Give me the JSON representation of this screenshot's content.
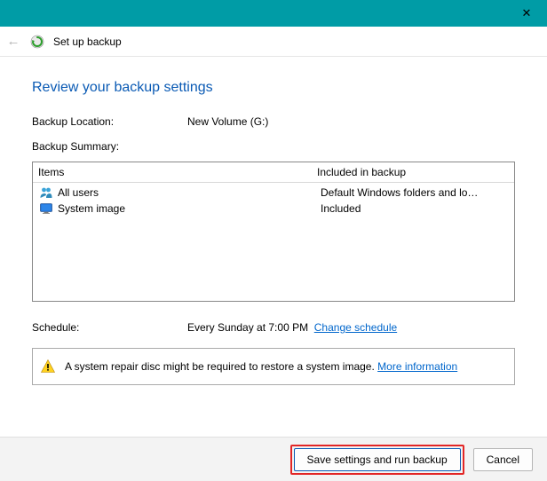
{
  "titlebar": {
    "close_glyph": "✕"
  },
  "crumb": {
    "title": "Set up backup"
  },
  "page": {
    "title": "Review your backup settings",
    "location_label": "Backup Location:",
    "location_value": "New Volume (G:)",
    "summary_label": "Backup Summary:",
    "col_items": "Items",
    "col_included": "Included in backup",
    "rows": [
      {
        "name": "All users",
        "included": "Default Windows folders and lo…"
      },
      {
        "name": "System image",
        "included": "Included"
      }
    ],
    "schedule_label": "Schedule:",
    "schedule_value": "Every Sunday at 7:00 PM",
    "change_schedule": "Change schedule",
    "info_text": "A system repair disc might be required to restore a system image. ",
    "more_info": "More information"
  },
  "footer": {
    "save": "Save settings and run backup",
    "cancel": "Cancel"
  }
}
